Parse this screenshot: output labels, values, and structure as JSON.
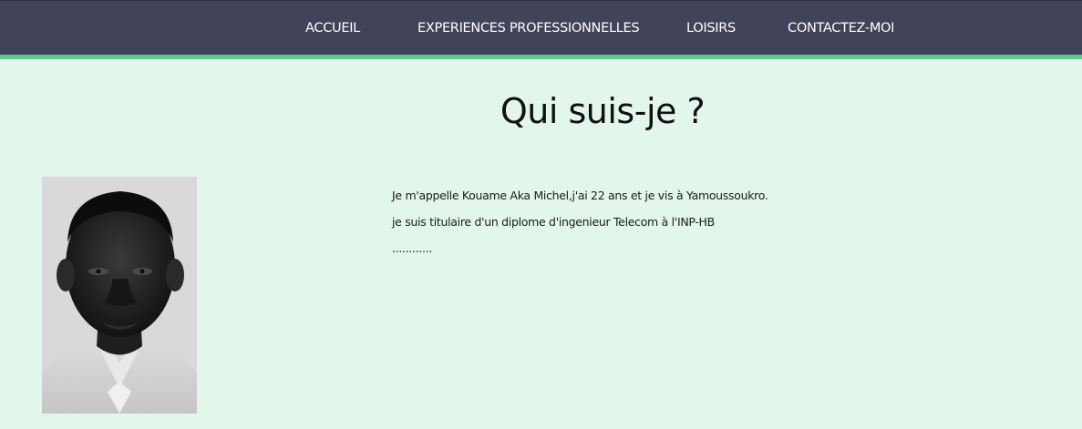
{
  "nav": {
    "items": [
      {
        "label": "ACCUEIL"
      },
      {
        "label": "EXPERIENCES PROFESSIONNELLES"
      },
      {
        "label": "LOISIRS"
      },
      {
        "label": "CONTACTEZ-MOI"
      }
    ]
  },
  "main": {
    "title": "Qui suis-je ?",
    "bio": {
      "line1": "Je m'appelle Kouame Aka Michel,j'ai 22 ans et je vis à Yamoussoukro.",
      "line2": "je suis titulaire d'un diplome d'ingenieur Telecom à l'INP-HB",
      "line3": "............"
    }
  },
  "colors": {
    "navbar_bg": "#41435a",
    "navbar_accent": "#5fc98c",
    "page_bg": "#e2f6ec"
  }
}
